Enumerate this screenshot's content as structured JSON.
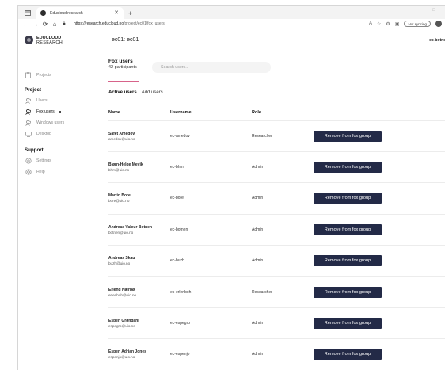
{
  "browser": {
    "tab_title": "Educloud research",
    "url_host": "https://research.educloud.no",
    "url_path": "/project/ec01/fox_users",
    "sync_label": "Not syncing"
  },
  "header": {
    "logo_line1": "EDUCLOUD",
    "logo_line2": "RESEARCH",
    "project_id": "ec01: ec01",
    "user_id": "ec-botnen"
  },
  "sidebar": {
    "projects_label": "Projects",
    "project_heading": "Project",
    "items": [
      {
        "label": "Users"
      },
      {
        "label": "Fox users"
      },
      {
        "label": "Windows users"
      },
      {
        "label": "Desktop"
      }
    ],
    "support_heading": "Support",
    "support_items": [
      {
        "label": "Settings"
      },
      {
        "label": "Help"
      }
    ]
  },
  "main": {
    "group_title": "Fox users",
    "participants": "42 participants",
    "search_placeholder": "Search users..",
    "tab_active": "Active users",
    "tab_add": "Add users",
    "columns": {
      "name": "Name",
      "username": "Username",
      "role": "Role"
    },
    "remove_label": "Remove from fox group",
    "rows": [
      {
        "name": "Safet Amedov",
        "email": "amedov@uio.no",
        "username": "ec-amedov",
        "role": "Researcher"
      },
      {
        "name": "Bjørn-Helge Mevik",
        "email": "bhm@uio.no",
        "username": "ec-bhm",
        "role": "Admin"
      },
      {
        "name": "Martin Bore",
        "email": "bore@uio.no",
        "username": "ec-bore",
        "role": "Admin"
      },
      {
        "name": "Andreas Valeur Botnen",
        "email": "botnen@uio.no",
        "username": "ec-botnen",
        "role": "Admin"
      },
      {
        "name": "Andreas Skau",
        "email": "buzh@uio.no",
        "username": "ec-buzh",
        "role": "Admin"
      },
      {
        "name": "Erlend Nærbø",
        "email": "erlenboh@uio.no",
        "username": "ec-erlenboh",
        "role": "Researcher"
      },
      {
        "name": "Espen Grøndahl",
        "email": "espegro@uio.no",
        "username": "ec-espegro",
        "role": "Admin"
      },
      {
        "name": "Espen Adrian Jones",
        "email": "espenjo@uio.no",
        "username": "ec-espenjo",
        "role": "Admin"
      }
    ]
  }
}
